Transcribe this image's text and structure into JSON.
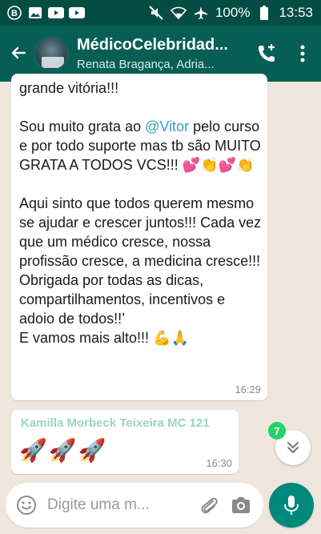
{
  "status_bar": {
    "battery": "100%",
    "time": "13:53",
    "icons": [
      "b-app-icon",
      "gallery-icon",
      "youtube-icon",
      "youtube-icon",
      "mute-icon",
      "wifi-icon",
      "airplane-icon",
      "battery-icon"
    ]
  },
  "header": {
    "title": "MédicoCelebridad...",
    "subtitle": "Renata Bragança, Adria..."
  },
  "messages": [
    {
      "lines": [
        "grande vitória!!!",
        "",
        "Sou muito grata ao ",
        "@Vitor",
        " pelo curso e por todo suporte mas tb são MUITO GRATA A TODOS VCS!!! ",
        "💕👏💕👏",
        "\n\nAqui sinto que todos querem mesmo se ajudar e crescer juntos!!! Cada vez que um médico cresce, nossa profissão cresce, a medicina cresce!!!\nObrigada por todas as dicas, compartilhamentos, incentivos e adoio de todos!!’\nE vamos mais alto!!! ",
        "💪🙏"
      ],
      "time": "16:29"
    },
    {
      "sender": "Kamilla Morbeck Teixeira MC 121",
      "text": "🚀🚀🚀",
      "time": "16:30"
    }
  ],
  "scroll_badge": "7",
  "composer": {
    "placeholder": "Digite uma m..."
  },
  "colors": {
    "header": "#075e54",
    "status_bar": "#054d44",
    "chat_bg": "#efe7dd",
    "mention": "#34a0c5",
    "sender": "#9ad4c2",
    "badge": "#25d366",
    "mic": "#00897b"
  }
}
